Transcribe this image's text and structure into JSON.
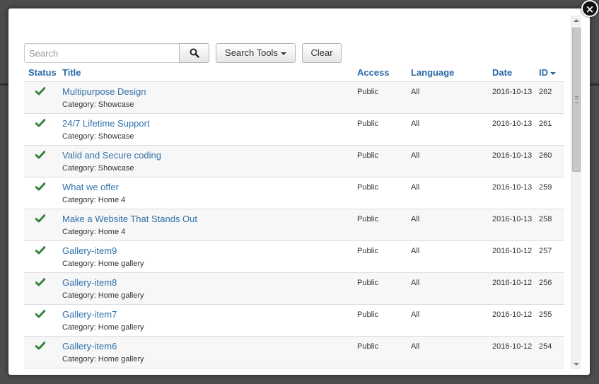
{
  "search": {
    "placeholder": "Search",
    "value": "",
    "button_icon": "search-icon",
    "tools_label": "Search Tools",
    "clear_label": "Clear"
  },
  "modal": {
    "close_label": "×"
  },
  "colors": {
    "link": "#3071a9",
    "header": "#2a69a6",
    "published": "#378137"
  },
  "table": {
    "columns": {
      "status": "Status",
      "title": "Title",
      "access": "Access",
      "language": "Language",
      "date": "Date",
      "id": "ID"
    },
    "sort": {
      "column": "ID",
      "direction": "desc"
    },
    "rows": [
      {
        "status": "published",
        "title": "Multipurpose Design",
        "category": "Category: Showcase",
        "access": "Public",
        "language": "All",
        "date": "2016-10-13",
        "id": "262"
      },
      {
        "status": "published",
        "title": "24/7 Lifetime Support",
        "category": "Category: Showcase",
        "access": "Public",
        "language": "All",
        "date": "2016-10-13",
        "id": "261"
      },
      {
        "status": "published",
        "title": "Valid and Secure coding",
        "category": "Category: Showcase",
        "access": "Public",
        "language": "All",
        "date": "2016-10-13",
        "id": "260"
      },
      {
        "status": "published",
        "title": "What we offer",
        "category": "Category: Home 4",
        "access": "Public",
        "language": "All",
        "date": "2016-10-13",
        "id": "259"
      },
      {
        "status": "published",
        "title": "Make a Website That Stands Out",
        "category": "Category: Home 4",
        "access": "Public",
        "language": "All",
        "date": "2016-10-13",
        "id": "258"
      },
      {
        "status": "published",
        "title": "Gallery-item9",
        "category": "Category: Home gallery",
        "access": "Public",
        "language": "All",
        "date": "2016-10-12",
        "id": "257"
      },
      {
        "status": "published",
        "title": "Gallery-item8",
        "category": "Category: Home gallery",
        "access": "Public",
        "language": "All",
        "date": "2016-10-12",
        "id": "256"
      },
      {
        "status": "published",
        "title": "Gallery-item7",
        "category": "Category: Home gallery",
        "access": "Public",
        "language": "All",
        "date": "2016-10-12",
        "id": "255"
      },
      {
        "status": "published",
        "title": "Gallery-item6",
        "category": "Category: Home gallery",
        "access": "Public",
        "language": "All",
        "date": "2016-10-12",
        "id": "254"
      }
    ]
  }
}
